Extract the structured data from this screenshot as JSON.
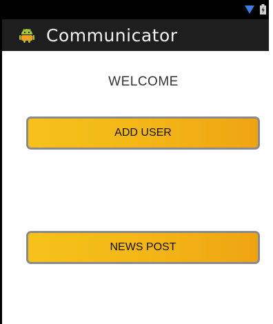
{
  "status_bar": {
    "icons": [
      "wifi-icon",
      "battery-charging-icon"
    ],
    "wifi_color": "#3d7fe0"
  },
  "action_bar": {
    "app_icon": "android-icon",
    "title": "Communicator"
  },
  "main": {
    "welcome_text": "WELCOME",
    "buttons": [
      {
        "label": "ADD USER"
      },
      {
        "label": "NEWS POST"
      }
    ]
  },
  "colors": {
    "button_fill": "#f3b516",
    "button_border": "#8a8a8a",
    "action_bar": "#1e1e1e"
  }
}
